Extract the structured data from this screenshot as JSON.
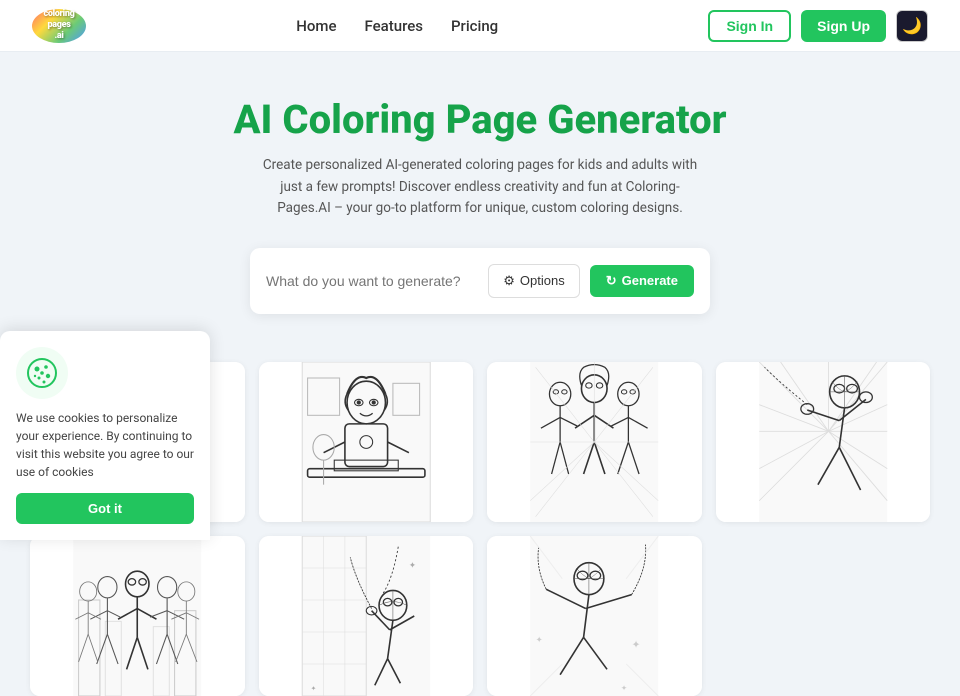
{
  "nav": {
    "logo_line1": "coloring",
    "logo_line2": "pages",
    "logo_line3": ".ai",
    "links": [
      {
        "label": "Home",
        "href": "#"
      },
      {
        "label": "Features",
        "href": "#"
      },
      {
        "label": "Pricing",
        "href": "#"
      }
    ],
    "signin_label": "Sign In",
    "signup_label": "Sign Up",
    "theme_icon": "🌙"
  },
  "hero": {
    "title": "AI Coloring Page Generator",
    "subtitle": "Create personalized AI-generated coloring pages for kids and adults with just a few prompts! Discover endless creativity and fun at Coloring-Pages.AI – your go-to platform for unique, custom coloring designs."
  },
  "search": {
    "placeholder": "What do you want to generate?",
    "options_label": "Options",
    "generate_label": "Generate"
  },
  "gallery": {
    "rows": 2,
    "cols": 4
  },
  "cookie": {
    "text": "We use cookies to personalize your experience. By continuing to visit this website you agree to our use of cookies",
    "button_label": "Got it"
  }
}
